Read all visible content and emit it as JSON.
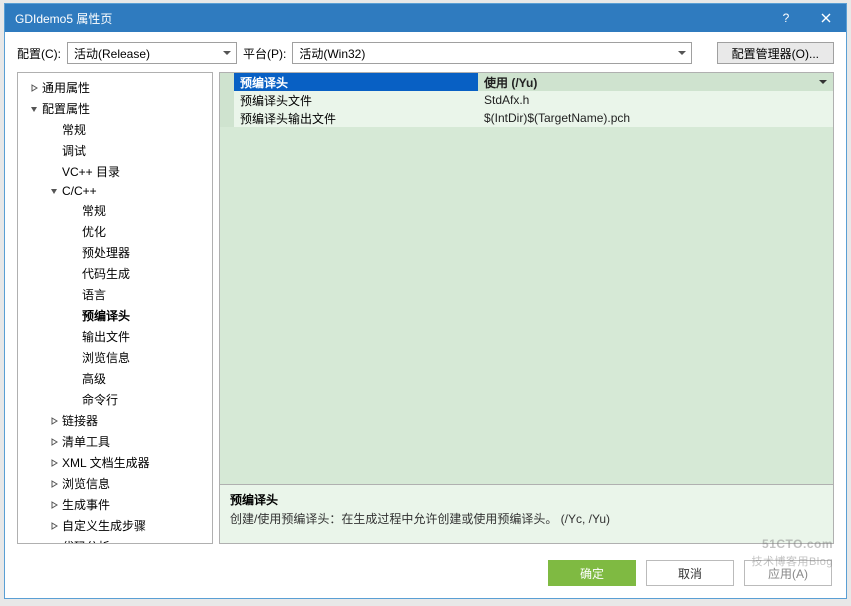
{
  "titlebar": {
    "title": "GDIdemo5 属性页"
  },
  "toolbar": {
    "config_label": "配置(C):",
    "config_value": "活动(Release)",
    "platform_label": "平台(P):",
    "platform_value": "活动(Win32)",
    "cfg_manager": "配置管理器(O)..."
  },
  "tree": [
    {
      "label": "通用属性",
      "level": 0,
      "twist": "closed"
    },
    {
      "label": "配置属性",
      "level": 0,
      "twist": "open"
    },
    {
      "label": "常规",
      "level": 1
    },
    {
      "label": "调试",
      "level": 1
    },
    {
      "label": "VC++ 目录",
      "level": 1
    },
    {
      "label": "C/C++",
      "level": 1,
      "twist": "open"
    },
    {
      "label": "常规",
      "level": 2
    },
    {
      "label": "优化",
      "level": 2
    },
    {
      "label": "预处理器",
      "level": 2
    },
    {
      "label": "代码生成",
      "level": 2
    },
    {
      "label": "语言",
      "level": 2
    },
    {
      "label": "预编译头",
      "level": 2,
      "selected": true
    },
    {
      "label": "输出文件",
      "level": 2
    },
    {
      "label": "浏览信息",
      "level": 2
    },
    {
      "label": "高级",
      "level": 2
    },
    {
      "label": "命令行",
      "level": 2
    },
    {
      "label": "链接器",
      "level": 1,
      "twist": "closed"
    },
    {
      "label": "清单工具",
      "level": 1,
      "twist": "closed"
    },
    {
      "label": "XML 文档生成器",
      "level": 1,
      "twist": "closed"
    },
    {
      "label": "浏览信息",
      "level": 1,
      "twist": "closed"
    },
    {
      "label": "生成事件",
      "level": 1,
      "twist": "closed"
    },
    {
      "label": "自定义生成步骤",
      "level": 1,
      "twist": "closed"
    },
    {
      "label": "代码分析",
      "level": 1,
      "twist": "closed"
    }
  ],
  "grid": {
    "header": {
      "name": "预编译头",
      "value": "使用 (/Yu)"
    },
    "rows": [
      {
        "name": "预编译头文件",
        "value": "StdAfx.h"
      },
      {
        "name": "预编译头输出文件",
        "value": "$(IntDir)$(TargetName).pch"
      }
    ]
  },
  "desc": {
    "title": "预编译头",
    "text": "创建/使用预编译头：在生成过程中允许创建或使用预编译头。     (/Yc, /Yu)"
  },
  "footer": {
    "ok": "确定",
    "cancel": "取消",
    "apply": "应用(A)"
  },
  "watermark": {
    "main": "51CTO.com",
    "sub": "技术博客用Blog"
  }
}
